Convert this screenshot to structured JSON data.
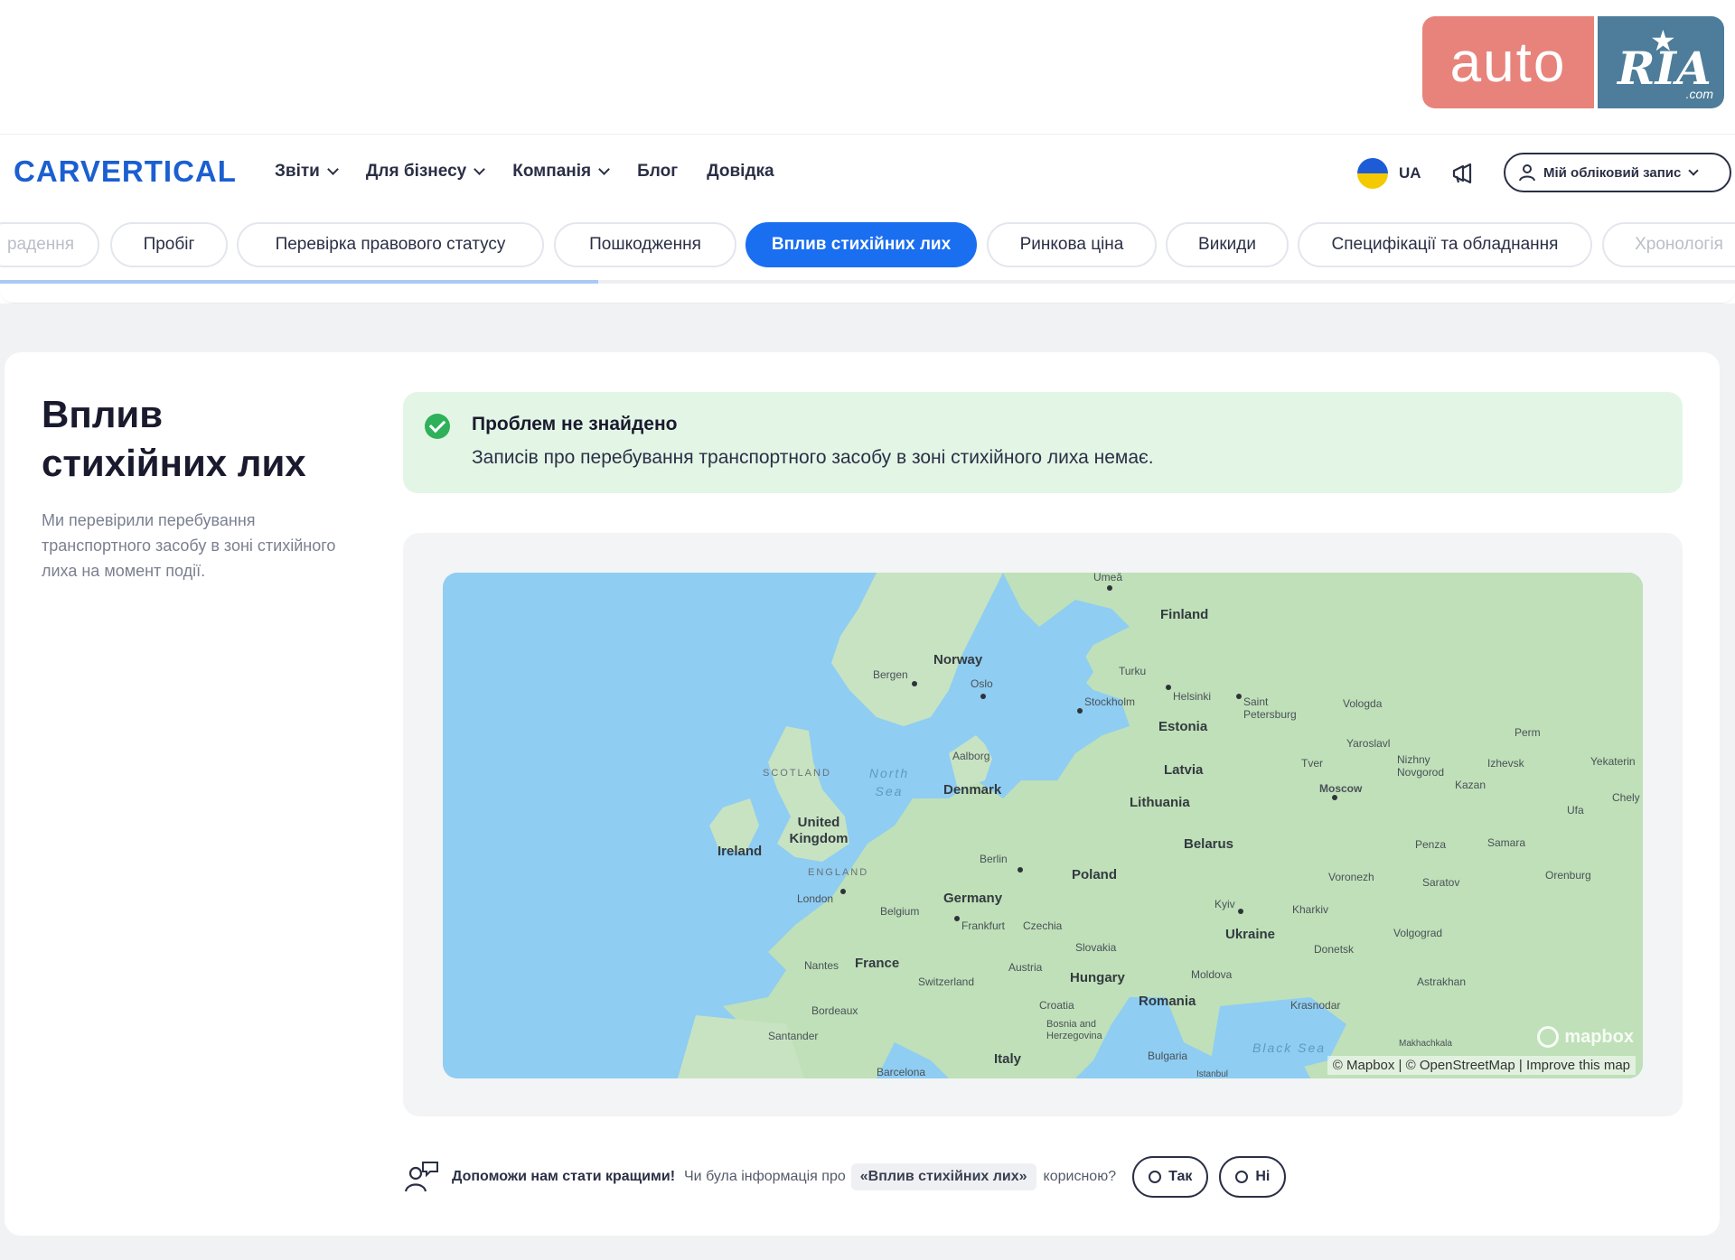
{
  "watermark": {
    "auto": "auto",
    "ria": "RIA",
    "com": ".com"
  },
  "header": {
    "logo": "CARVERTICAL",
    "nav": [
      {
        "label": "Звіти",
        "dropdown": true
      },
      {
        "label": "Для бізнесу",
        "dropdown": true
      },
      {
        "label": "Компанія",
        "dropdown": true
      },
      {
        "label": "Блог",
        "dropdown": false
      },
      {
        "label": "Довідка",
        "dropdown": false
      }
    ],
    "lang": "UA",
    "account": "Мій обліковий запис"
  },
  "tabs": [
    {
      "label": "радення",
      "state": "faded"
    },
    {
      "label": "Пробіг",
      "state": "normal"
    },
    {
      "label": "Перевірка правового статусу",
      "state": "normal"
    },
    {
      "label": "Пошкодження",
      "state": "normal"
    },
    {
      "label": "Вплив стихійних лих",
      "state": "active"
    },
    {
      "label": "Ринкова ціна",
      "state": "normal"
    },
    {
      "label": "Викиди",
      "state": "normal"
    },
    {
      "label": "Специфікації та обладнання",
      "state": "normal"
    },
    {
      "label": "Хронологія",
      "state": "faded"
    }
  ],
  "section": {
    "title": "Вплив стихійних лих",
    "description": "Ми перевірили перебування транспортного засобу в зоні стихійного лиха на момент події."
  },
  "alert": {
    "title": "Проблем не знайдено",
    "text": "Записів про перебування транспортного засобу в зоні стихійного лиха немає."
  },
  "map": {
    "countries": [
      "Finland",
      "Norway",
      "Estonia",
      "Latvia",
      "Lithuania",
      "Denmark",
      "United Kingdom",
      "Ireland",
      "Belarus",
      "Poland",
      "Germany",
      "Belgium",
      "Czechia",
      "Slovakia",
      "Ukraine",
      "Moldova",
      "France",
      "Switzerland",
      "Austria",
      "Hungary",
      "Romania",
      "Croatia",
      "Bosnia and Herzegovina",
      "Italy",
      "Bulgaria"
    ],
    "cities": [
      "Umeå",
      "Bergen",
      "Oslo",
      "Turku",
      "Helsinki",
      "Stockholm",
      "Saint Petersburg",
      "Vologda",
      "Perm",
      "Yaroslavl",
      "Tver",
      "Nizhny Novgorod",
      "Izhevsk",
      "Yekaterin",
      "Moscow",
      "Kazan",
      "Chely",
      "Aalborg",
      "Ufa",
      "Berlin",
      "London",
      "Penza",
      "Samara",
      "Voronezh",
      "Orenburg",
      "Saratov",
      "Kyiv",
      "Kharkiv",
      "Frankfurt",
      "Donetsk",
      "Volgograd",
      "Nantes",
      "Astrakhan",
      "Krasnodar",
      "Bordeaux",
      "Santander",
      "Makhachkala",
      "Barcelona",
      "Istanbul"
    ],
    "regions": [
      "SCOTLAND",
      "ENGLAND"
    ],
    "seas": [
      "North Sea",
      "Black Sea"
    ],
    "attribution": "© Mapbox | © OpenStreetMap | Improve this map",
    "logo": "mapbox"
  },
  "feedback": {
    "strong": "Допоможи нам стати кращими!",
    "question": "Чи була інформація про",
    "tag": "«Вплив стихійних лих»",
    "question_end": "корисною?",
    "yes": "Так",
    "no": "Ні"
  },
  "colors": {
    "brand": "#1b5fd1",
    "active_tab": "#1a6ef0",
    "success_bg": "#e3f6e6",
    "success_icon": "#2fb05a"
  }
}
